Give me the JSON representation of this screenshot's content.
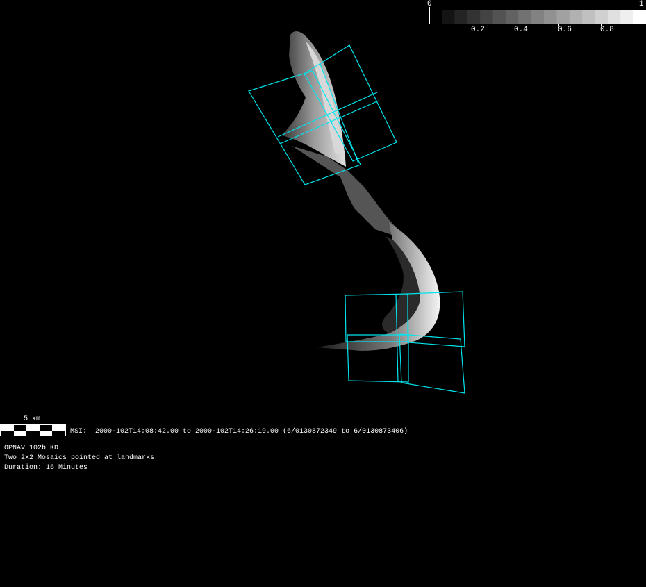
{
  "colorbar": {
    "min_label": "0",
    "max_label": "1",
    "ticks": [
      "0.2",
      "0.4",
      "0.6",
      "0.8"
    ],
    "steps": 16
  },
  "scale_bar": {
    "label": "5 km"
  },
  "info": {
    "msi_line": "MSI:  2000-102T14:08:42.00 to 2000-102T14:26:19.00 (6/0130872349 to 6/0130873406)",
    "title": "OPNAV 102b KD",
    "description": "Two 2x2 Mosaics pointed at landmarks",
    "duration": "Duration: 16 Minutes"
  },
  "colors": {
    "footprint": "#00e5ee",
    "background": "#000000"
  }
}
